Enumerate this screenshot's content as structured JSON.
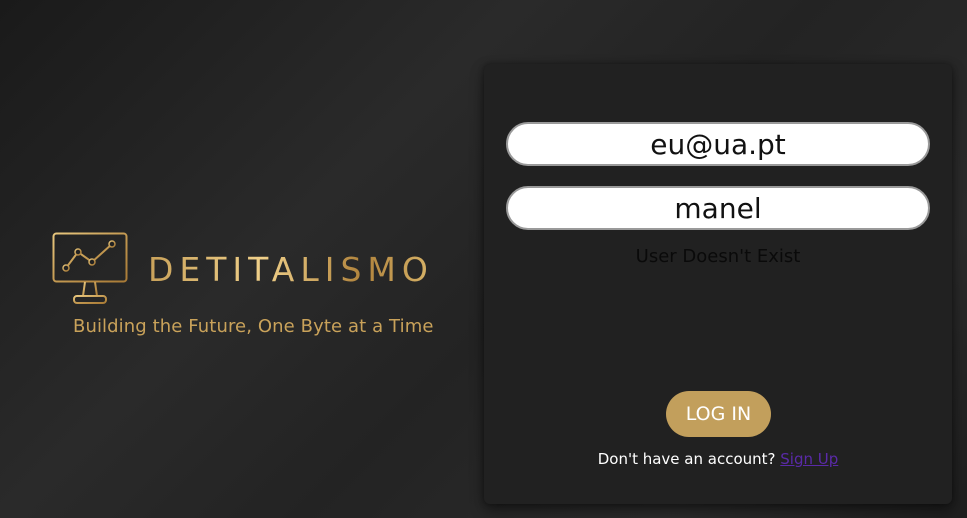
{
  "brand": {
    "name": "DETITALISMO",
    "tagline": "Building the Future, One Byte at a Time",
    "logo_icon": "monitor-chart-icon",
    "accent_color": "#c9a25a"
  },
  "login_form": {
    "email_value": "eu@ua.pt",
    "password_value": "manel",
    "error_message": "User Doesn't Exist",
    "login_label": "LOG IN",
    "signup_prompt": "Don't have an account?",
    "signup_link": "Sign Up",
    "button_color": "#c29f5c",
    "link_color": "#5a2aa8"
  }
}
